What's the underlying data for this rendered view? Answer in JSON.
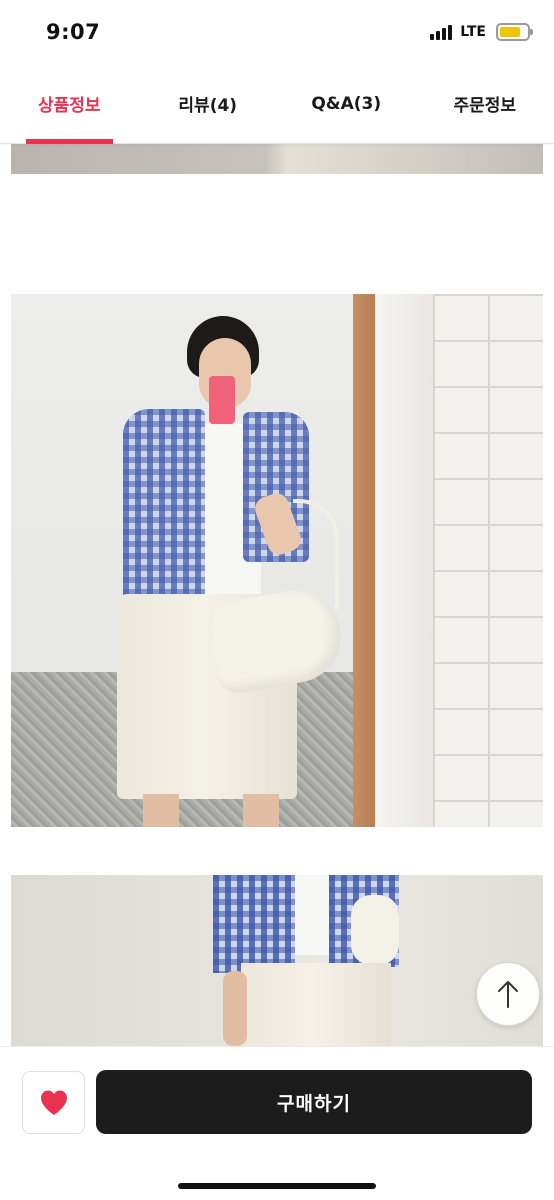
{
  "status_bar": {
    "time": "9:07",
    "network": "LTE",
    "battery_level": 0.75,
    "battery_color": "#f2c400"
  },
  "tabs": [
    {
      "label": "상품정보",
      "active": true
    },
    {
      "label": "리뷰(4)",
      "active": false
    },
    {
      "label": "Q&A(3)",
      "active": false
    },
    {
      "label": "주문정보",
      "active": false
    }
  ],
  "accent_color": "#e8324f",
  "scroll_top": {
    "icon": "arrow-up-icon"
  },
  "bottom_bar": {
    "like_icon": "heart-icon",
    "like_color": "#e8324f",
    "buy_label": "구매하기"
  }
}
